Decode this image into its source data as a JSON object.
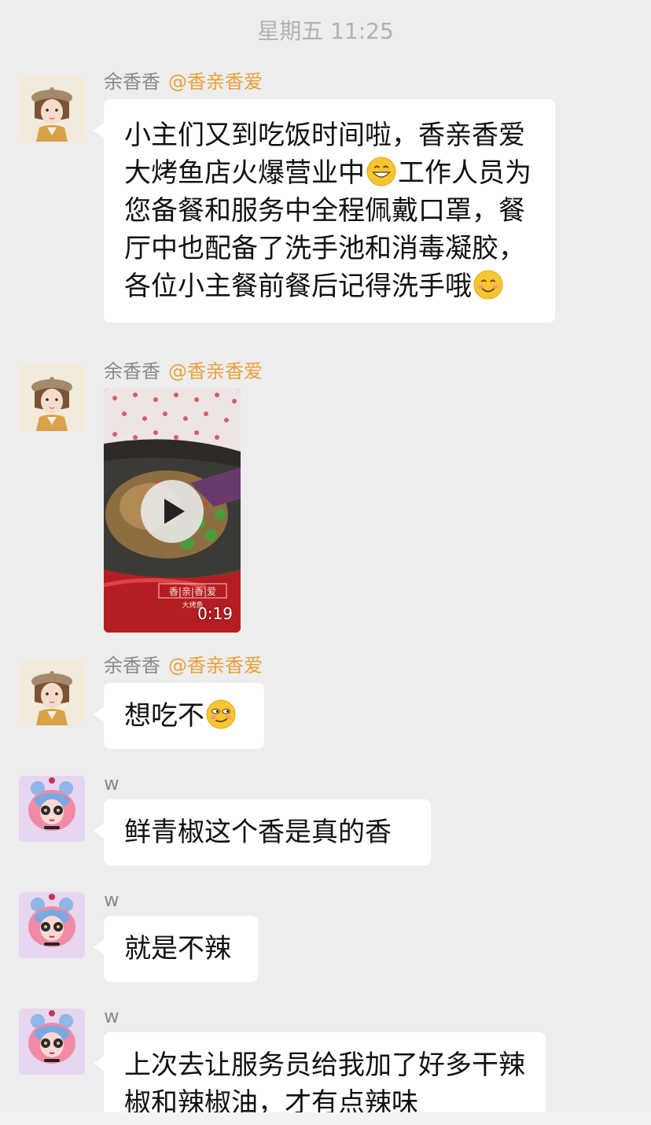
{
  "timestamp": "星期五 11:25",
  "messages": [
    {
      "sender": "余香香",
      "tag": "@香亲香爱",
      "text_parts": [
        "小主们又到吃饭时间啦，香亲香爱大烤鱼店火爆营业中",
        "工作人员为您备餐和服务中全程佩戴口罩，餐厅中也配备了洗手池和消毒凝胶，各位小主餐前餐后记得洗手哦"
      ],
      "emojis": [
        "grin-emoji",
        "smile-emoji"
      ]
    },
    {
      "sender": "余香香",
      "tag": "@香亲香爱",
      "video": {
        "duration": "0:19",
        "label": "香|亲|香|爱",
        "sublabel": "大烤鱼"
      }
    },
    {
      "sender": "余香香",
      "tag": "@香亲香爱",
      "text": "想吃不",
      "emoji": "smirk-emoji"
    },
    {
      "sender": "w",
      "text": "鲜青椒这个香是真的香"
    },
    {
      "sender": "w",
      "text": "就是不辣"
    },
    {
      "sender": "w",
      "text": "上次去让服务员给我加了好多干辣椒和辣椒油，才有点辣味"
    }
  ]
}
